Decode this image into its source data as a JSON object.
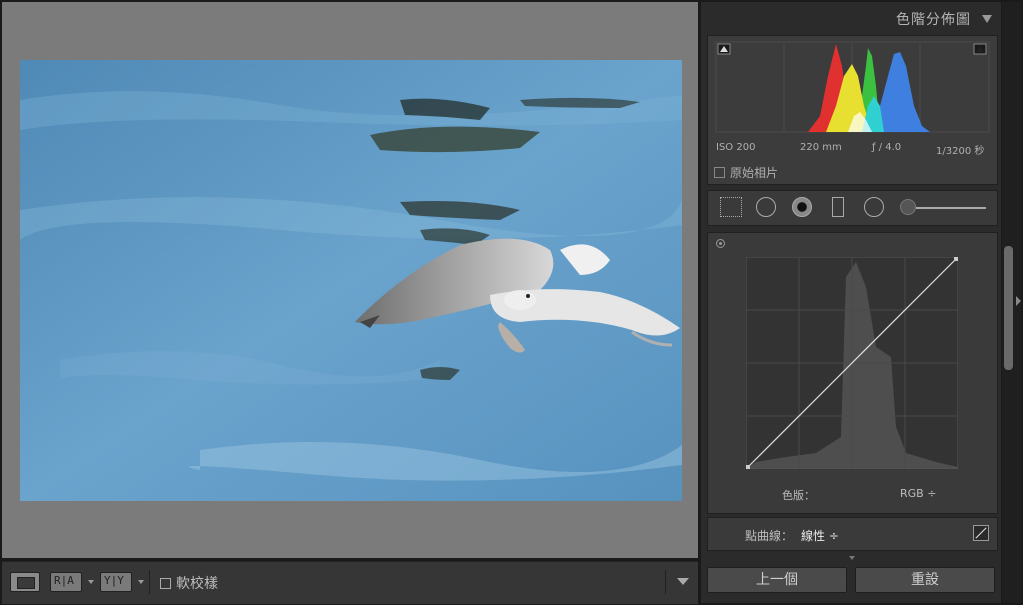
{
  "toolbar": {
    "view_mode_icon": "single-view-icon",
    "before_after_left": "R|A",
    "before_after_right": "Y|Y",
    "soft_proof_label": "軟校樣"
  },
  "histogram": {
    "title": "色階分佈圖",
    "iso": "ISO 200",
    "focal_length": "220 mm",
    "aperture": "ƒ / 4.0",
    "shutter": "1/3200 秒",
    "original_photo_label": "原始相片"
  },
  "tools": [
    "crop-icon",
    "spot-removal-icon",
    "red-eye-icon",
    "graduated-filter-icon",
    "radial-filter-icon",
    "adjustment-brush-icon"
  ],
  "tone_curve": {
    "channel_label": "色版：",
    "channel_value": "RGB ÷",
    "point_curve_label": "點曲線：",
    "point_curve_value": "線性 ÷"
  },
  "buttons": {
    "previous": "上一個",
    "reset": "重設"
  },
  "colors": {
    "panel_bg": "#2b2b2b",
    "canvas_bg": "#7b7b7b",
    "water": "#5f96bf",
    "hist_red": "#e03030",
    "hist_green": "#3cc040",
    "hist_blue": "#3f7fe0",
    "hist_yellow": "#e8e030",
    "hist_cyan": "#30d0d0"
  }
}
